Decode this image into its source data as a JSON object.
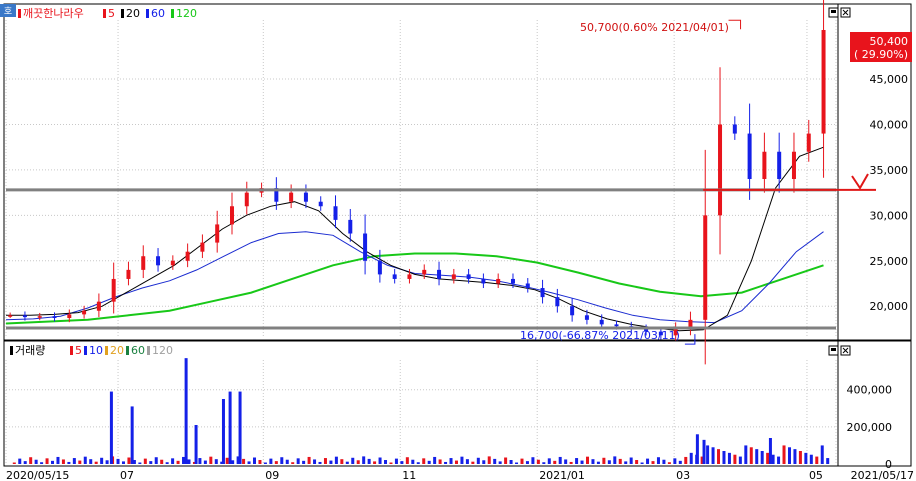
{
  "window": {
    "price_legend": [
      "깨끗한나라우",
      "5",
      "20",
      "60",
      "120"
    ],
    "volume_legend": [
      "거래량",
      "5",
      "10",
      "20",
      "60",
      "120"
    ],
    "icon": "corner-badge-icon"
  },
  "colors": {
    "up": "#e8141c",
    "down": "#1420e8",
    "ma5": "#d01010",
    "ma20": "#000000",
    "ma60": "#1a2bd0",
    "ma120": "#18c818",
    "ref_gray": "#808080",
    "ref_red": "#e01818",
    "price_badge": "#e8141c"
  },
  "annotations": {
    "high_label": "50,700(0.60% 2021/04/01)",
    "low_label": "16,700(-66.87% 2021/03/11)",
    "last_price": "50,400",
    "last_change": "( 29.90%)"
  },
  "chart_data": [
    {
      "type": "candlestick",
      "title": "깨끗한나라우",
      "x_start": "2020/05/15",
      "x_end": "2021/05/17",
      "x_tick_labels": [
        "2020/05/15",
        "07",
        "09",
        "11",
        "2021/01",
        "03",
        "05",
        "2021/05/17"
      ],
      "y_tick_labels": [
        "20,000",
        "25,000",
        "30,000",
        "35,000",
        "40,000",
        "45,000"
      ],
      "ylim": [
        16500,
        51500
      ],
      "grid": true,
      "series": [
        {
          "name": "5",
          "values_desc": "5-day MA"
        },
        {
          "name": "20",
          "values_desc": "20-day MA"
        },
        {
          "name": "60",
          "values_desc": "60-day MA"
        },
        {
          "name": "120",
          "values_desc": "120-day MA"
        }
      ],
      "closes": [
        19000,
        18800,
        18900,
        18700,
        19100,
        19500,
        20500,
        23000,
        24000,
        25500,
        24500,
        25000,
        26000,
        27000,
        29000,
        31000,
        32500,
        33000,
        31500,
        32500,
        31500,
        31000,
        29500,
        28000,
        25000,
        23500,
        23000,
        23500,
        24000,
        23000,
        23500,
        23000,
        22500,
        23000,
        22500,
        22000,
        21000,
        20000,
        19000,
        18500,
        18000,
        17800,
        17500,
        17200,
        16800,
        17500,
        18500,
        30000,
        40000,
        39000,
        34000,
        37000,
        34000,
        37000,
        39000,
        50400
      ],
      "ma20": [
        19000,
        19000,
        19100,
        19300,
        20000,
        21500,
        23000,
        24500,
        26500,
        28500,
        30000,
        31000,
        31500,
        30500,
        28000,
        26000,
        24500,
        23500,
        23000,
        22800,
        22600,
        22300,
        21800,
        20800,
        19500,
        18600,
        18000,
        17600,
        17300,
        17400,
        19000,
        25000,
        33000,
        36500,
        37500
      ],
      "ma60": [
        18500,
        18600,
        18900,
        19800,
        21000,
        22000,
        22800,
        24000,
        25500,
        27000,
        28000,
        28200,
        27800,
        26000,
        24500,
        23600,
        23400,
        23200,
        22800,
        22200,
        21500,
        20700,
        19800,
        19000,
        18500,
        18300,
        18200,
        19500,
        22500,
        26000,
        28200
      ],
      "ma120": [
        18100,
        18300,
        18500,
        19000,
        19500,
        20500,
        21500,
        23000,
        24500,
        25500,
        25800,
        25800,
        25500,
        24800,
        23700,
        22500,
        21600,
        21100,
        21500,
        23000,
        24500
      ],
      "reference_lines": [
        {
          "price": 32800,
          "label": "gray-resistance"
        },
        {
          "price": 17600,
          "label": "gray-support"
        },
        {
          "price": 32800,
          "label": "red-recent"
        }
      ],
      "high": {
        "price": 50700,
        "date": "2021/04/01",
        "change": "0.60%"
      },
      "low": {
        "price": 16700,
        "date": "2021/03/11",
        "change": "-66.87%"
      },
      "last": {
        "price": 50400,
        "change_pct": 29.9
      }
    },
    {
      "type": "bar",
      "title": "거래량",
      "y_tick_labels": [
        "0",
        "200,000",
        "400,000"
      ],
      "ylim": [
        0,
        560000
      ],
      "series": [
        {
          "name": "5"
        },
        {
          "name": "10"
        },
        {
          "name": "20"
        },
        {
          "name": "60"
        },
        {
          "name": "120"
        }
      ],
      "spikes": [
        {
          "pos": 0.127,
          "value": 390000
        },
        {
          "pos": 0.152,
          "value": 310000
        },
        {
          "pos": 0.217,
          "value": 570000
        },
        {
          "pos": 0.229,
          "value": 210000
        },
        {
          "pos": 0.282,
          "value": 390000
        },
        {
          "pos": 0.262,
          "value": 350000
        },
        {
          "pos": 0.27,
          "value": 390000
        },
        {
          "pos": 0.833,
          "value": 160000
        },
        {
          "pos": 0.841,
          "value": 130000
        },
        {
          "pos": 0.921,
          "value": 140000
        }
      ]
    }
  ]
}
